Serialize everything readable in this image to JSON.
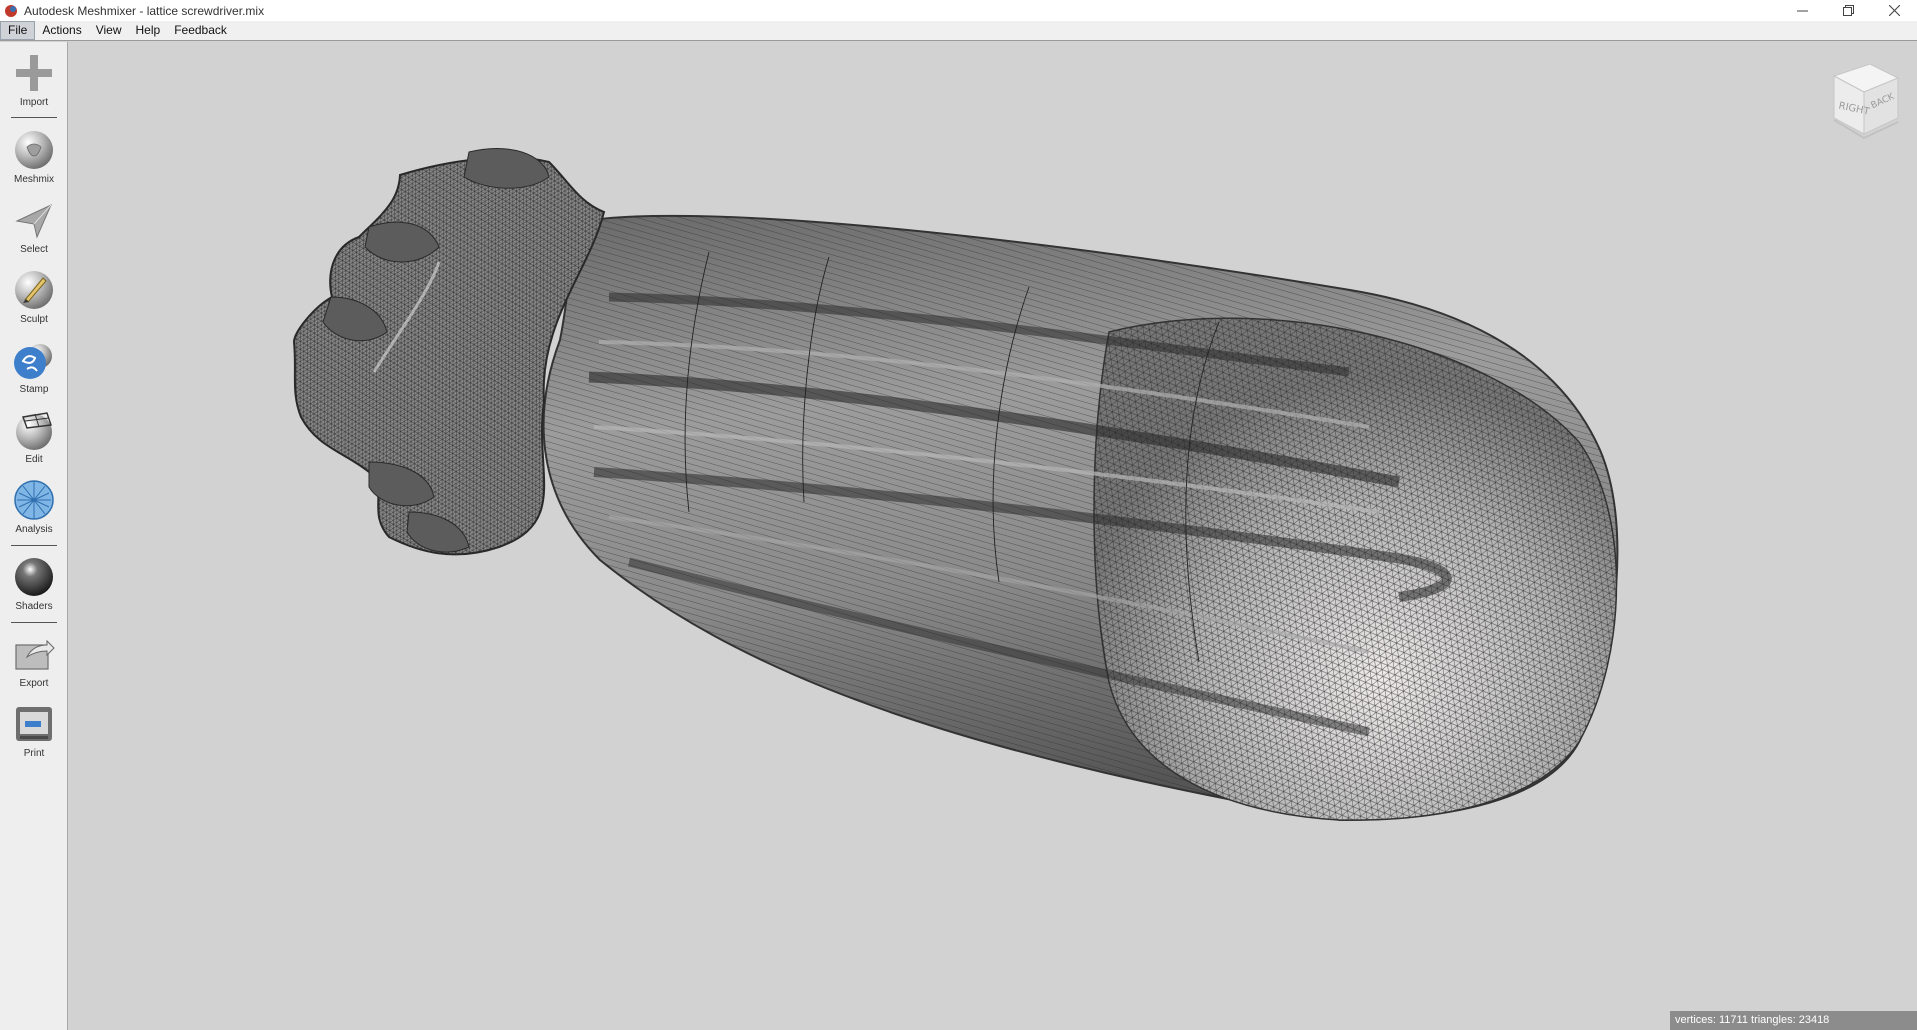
{
  "window": {
    "title": "Autodesk Meshmixer - lattice screwdriver.mix",
    "icon": "meshmixer-logo-icon",
    "controls": [
      "minimize-icon",
      "restore-icon",
      "close-icon"
    ]
  },
  "menu": {
    "items": [
      {
        "label": "File",
        "active": true
      },
      {
        "label": "Actions"
      },
      {
        "label": "View"
      },
      {
        "label": "Help"
      },
      {
        "label": "Feedback"
      }
    ]
  },
  "toolbar": {
    "tools": [
      {
        "label": "Import",
        "icon": "plus-icon"
      },
      {
        "label": "Meshmix",
        "icon": "meshmix-bunny-icon"
      },
      {
        "label": "Select",
        "icon": "select-arrow-icon"
      },
      {
        "label": "Sculpt",
        "icon": "sculpt-brush-icon"
      },
      {
        "label": "Stamp",
        "icon": "stamp-icon"
      },
      {
        "label": "Edit",
        "icon": "edit-icon"
      },
      {
        "label": "Analysis",
        "icon": "analysis-icon"
      },
      {
        "label": "Shaders",
        "icon": "shaders-sphere-icon"
      },
      {
        "label": "Export",
        "icon": "export-icon"
      },
      {
        "label": "Print",
        "icon": "printer-icon"
      }
    ]
  },
  "navcube": {
    "faces": [
      "RIGHT",
      "BACK"
    ]
  },
  "status": {
    "text": "vertices: 11711 triangles: 23418"
  },
  "colors": {
    "viewport_bg": "#d2d2d2",
    "toolbar_bg": "#eeeeee",
    "status_bg": "#8c8c8c",
    "mesh_fill": "#8f8f8f",
    "mesh_wire": "#2a2a2a"
  }
}
